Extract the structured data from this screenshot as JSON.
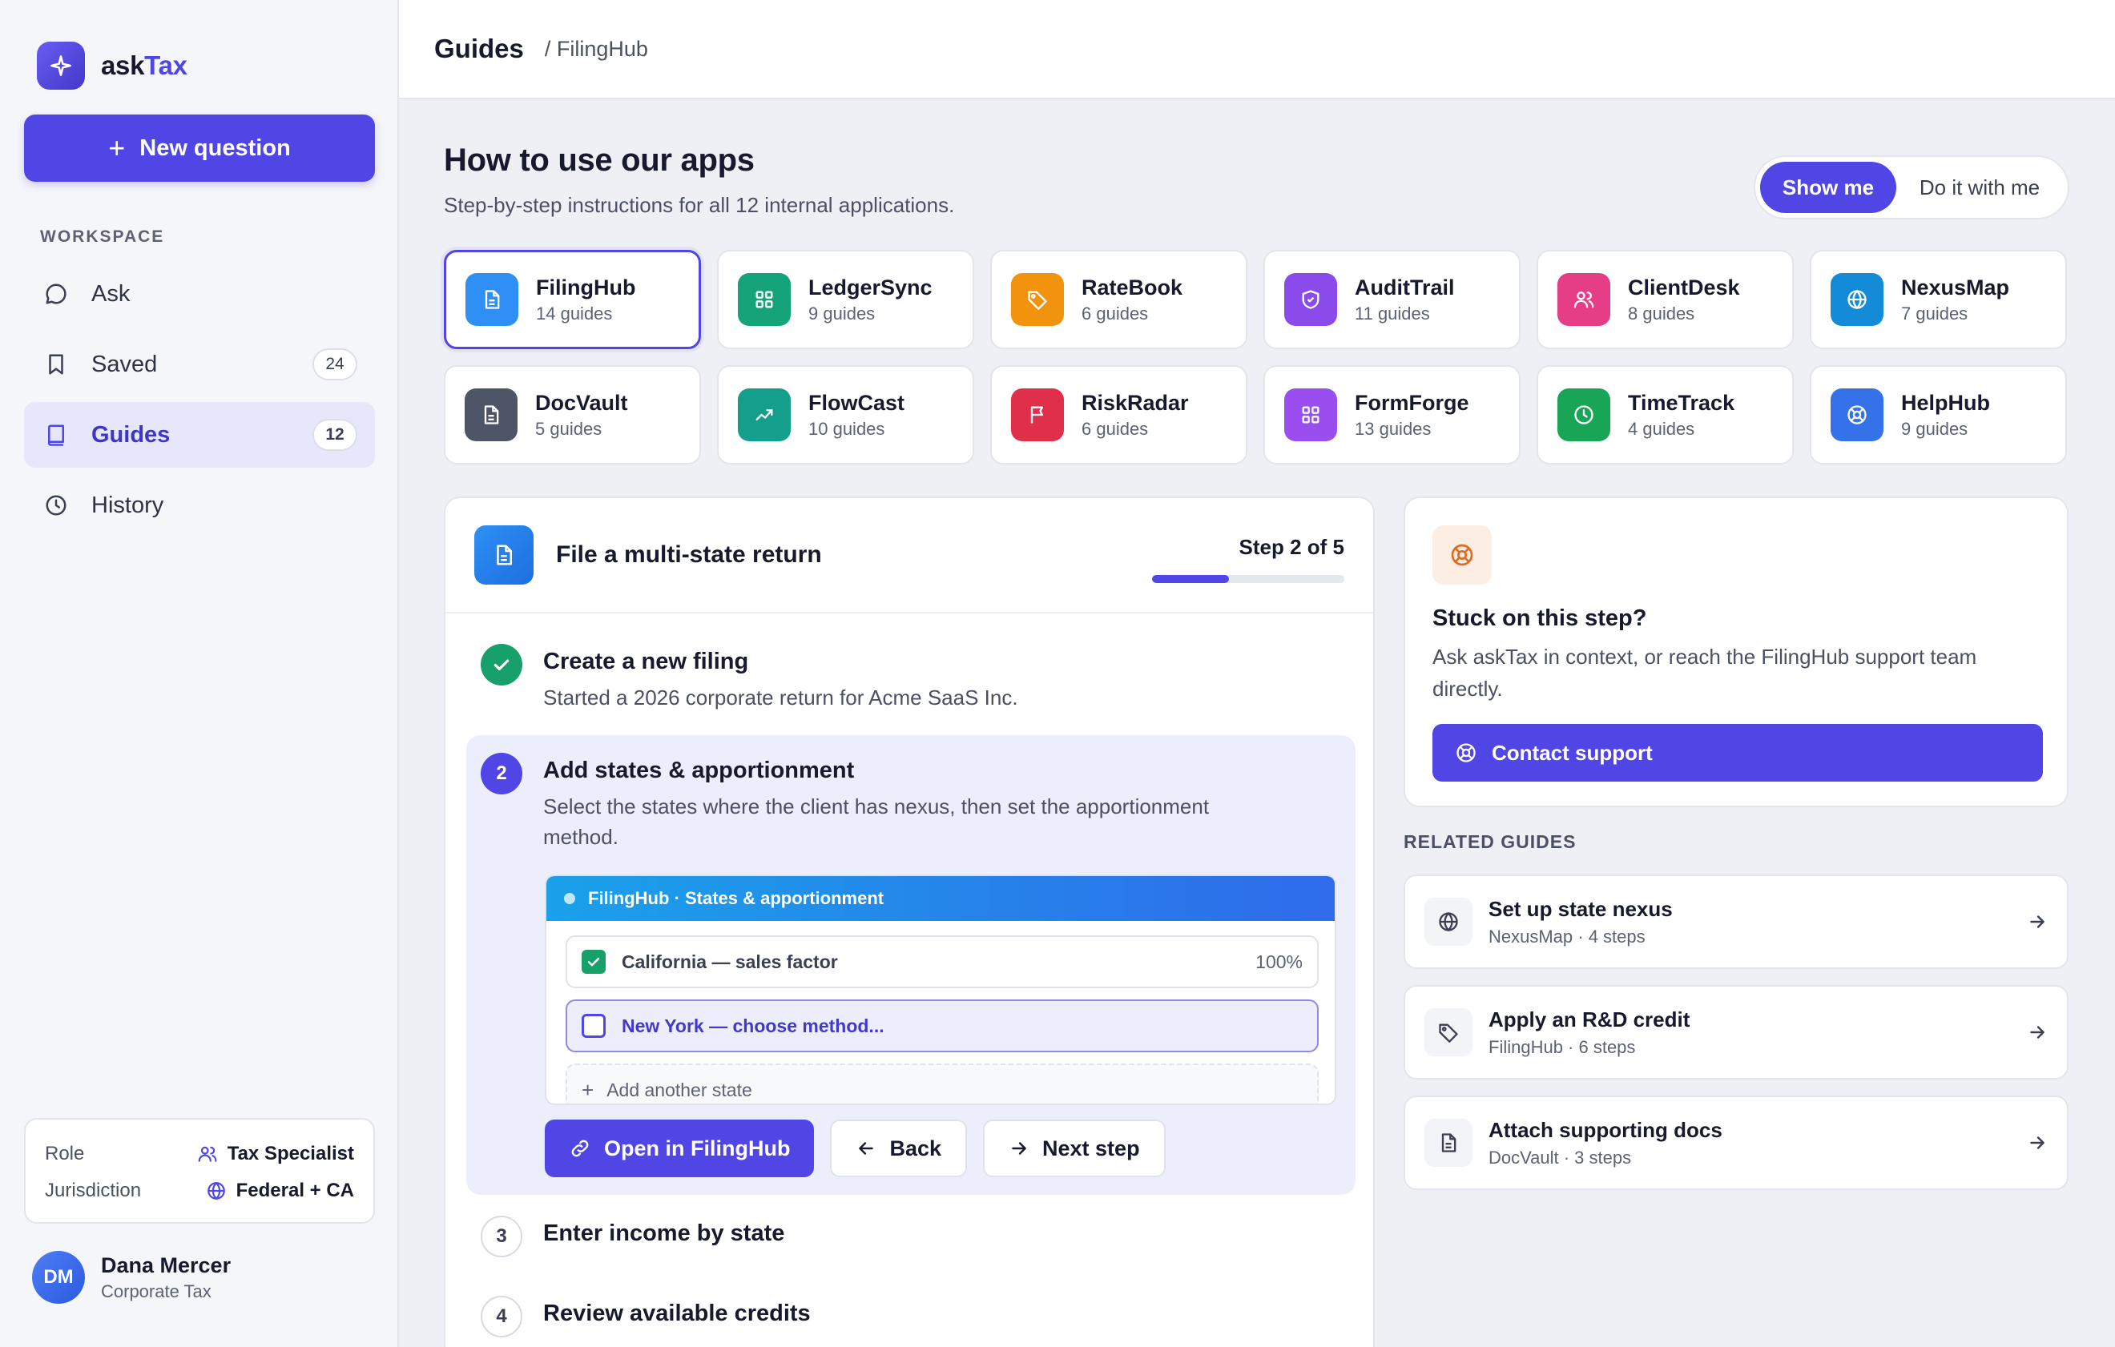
{
  "brand": {
    "name_prefix": "ask",
    "name_accent": "Tax"
  },
  "sidebar": {
    "new_question": "New question",
    "section_label": "WORKSPACE",
    "items": [
      {
        "label": "Ask",
        "icon": "chat-bubble-icon",
        "count": ""
      },
      {
        "label": "Saved",
        "icon": "bookmark-icon",
        "count": "24"
      },
      {
        "label": "Guides",
        "icon": "book-icon",
        "count": "12"
      },
      {
        "label": "History",
        "icon": "clock-icon",
        "count": ""
      }
    ],
    "role_label": "Role",
    "role_value": "Tax Specialist",
    "jurisdiction_label": "Jurisdiction",
    "jurisdiction_value": "Federal + CA",
    "user": {
      "initials": "DM",
      "name": "Dana Mercer",
      "department": "Corporate Tax"
    }
  },
  "header": {
    "title": "Guides",
    "breadcrumb": "/ FilingHub"
  },
  "main": {
    "title": "How to use our apps",
    "subtitle": "Step-by-step instructions for all 12 internal applications.",
    "mode_show": "Show me",
    "mode_do": "Do it with me",
    "apps": [
      {
        "name": "FilingHub",
        "count": "14 guides",
        "icon": "document-icon",
        "color": "#2f8ff4"
      },
      {
        "name": "LedgerSync",
        "count": "9 guides",
        "icon": "grid-icon",
        "color": "#15a37a"
      },
      {
        "name": "RateBook",
        "count": "6 guides",
        "icon": "tag-icon",
        "color": "#f2930e"
      },
      {
        "name": "AuditTrail",
        "count": "11 guides",
        "icon": "shield-icon",
        "color": "#8a4bea"
      },
      {
        "name": "ClientDesk",
        "count": "8 guides",
        "icon": "users-icon",
        "color": "#e53e86"
      },
      {
        "name": "NexusMap",
        "count": "7 guides",
        "icon": "globe-icon",
        "color": "#138bd6"
      },
      {
        "name": "DocVault",
        "count": "5 guides",
        "icon": "document-icon",
        "color": "#4d5567"
      },
      {
        "name": "FlowCast",
        "count": "10 guides",
        "icon": "trend-icon",
        "color": "#139f8c"
      },
      {
        "name": "RiskRadar",
        "count": "6 guides",
        "icon": "flag-icon",
        "color": "#e02f48"
      },
      {
        "name": "FormForge",
        "count": "13 guides",
        "icon": "grid-icon",
        "color": "#9a4ef0"
      },
      {
        "name": "TimeTrack",
        "count": "4 guides",
        "icon": "clock-icon",
        "color": "#18a555"
      },
      {
        "name": "HelpHub",
        "count": "9 guides",
        "icon": "lifebuoy-icon",
        "color": "#3572ea"
      }
    ]
  },
  "guide": {
    "title": "File a multi-state return",
    "step_indicator": "Step 2 of 5",
    "progress": 0.4,
    "steps": [
      {
        "num": "1",
        "title": "Create a new filing",
        "desc": "Started a 2026 corporate return for Acme SaaS Inc."
      },
      {
        "num": "2",
        "title": "Add states & apportionment",
        "desc": "Select the states where the client has nexus, then set the apportionment method."
      },
      {
        "num": "3",
        "title": "Enter income by state",
        "desc": ""
      },
      {
        "num": "4",
        "title": "Review available credits",
        "desc": ""
      }
    ],
    "preview": {
      "bar_title": "FilingHub · States & apportionment",
      "rows": [
        {
          "label": "California — sales factor",
          "value": "100%"
        },
        {
          "label": "New York — choose method...",
          "value": ""
        }
      ],
      "add_label": "Add another state"
    },
    "actions": {
      "open": "Open in FilingHub",
      "back": "Back",
      "next": "Next step"
    }
  },
  "support": {
    "title": "Stuck on this step?",
    "text": "Ask askTax in context, or reach the FilingHub support team directly.",
    "button": "Contact support"
  },
  "related": {
    "label": "RELATED GUIDES",
    "items": [
      {
        "title": "Set up state nexus",
        "meta": "NexusMap · 4 steps",
        "icon": "globe-icon"
      },
      {
        "title": "Apply an R&D credit",
        "meta": "FilingHub · 6 steps",
        "icon": "tag-icon"
      },
      {
        "title": "Attach supporting docs",
        "meta": "DocVault · 3 steps",
        "icon": "document-icon"
      }
    ]
  }
}
